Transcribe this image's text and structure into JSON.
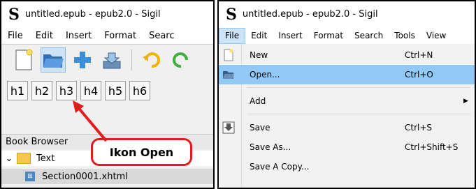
{
  "app": {
    "title": "untitled.epub - epub2.0 - Sigil",
    "logo_letter": "S"
  },
  "left": {
    "menus": [
      "File",
      "Edit",
      "Insert",
      "Format",
      "Searc"
    ],
    "headings": [
      "h1",
      "h2",
      "h3",
      "h4",
      "h5",
      "h6"
    ],
    "book_browser": "Book Browser",
    "tree": {
      "folder": "Text",
      "file": "Section0001.xhtml",
      "file_icon_glyph": "⊞"
    },
    "callout": "Ikon Open"
  },
  "right": {
    "menus": [
      "File",
      "Edit",
      "Insert",
      "Format",
      "Search",
      "Tools",
      "View"
    ],
    "dropdown": [
      {
        "label": "New",
        "shortcut": "Ctrl+N",
        "icon": "new-document-icon"
      },
      {
        "label": "Open...",
        "shortcut": "Ctrl+O",
        "icon": "open-folder-icon"
      },
      {
        "label": "Add",
        "shortcut": "",
        "icon": ""
      },
      {
        "label": "Save",
        "shortcut": "Ctrl+S",
        "icon": "save-icon"
      },
      {
        "label": "Save As...",
        "shortcut": "Ctrl+Shift+S",
        "icon": ""
      },
      {
        "label": "Save A Copy...",
        "shortcut": "",
        "icon": ""
      }
    ],
    "submenu_glyph": "▶"
  },
  "colors": {
    "highlight": "#91c9f7",
    "callout_red": "#e21b1b",
    "folder_yellow": "#f2c94c"
  }
}
